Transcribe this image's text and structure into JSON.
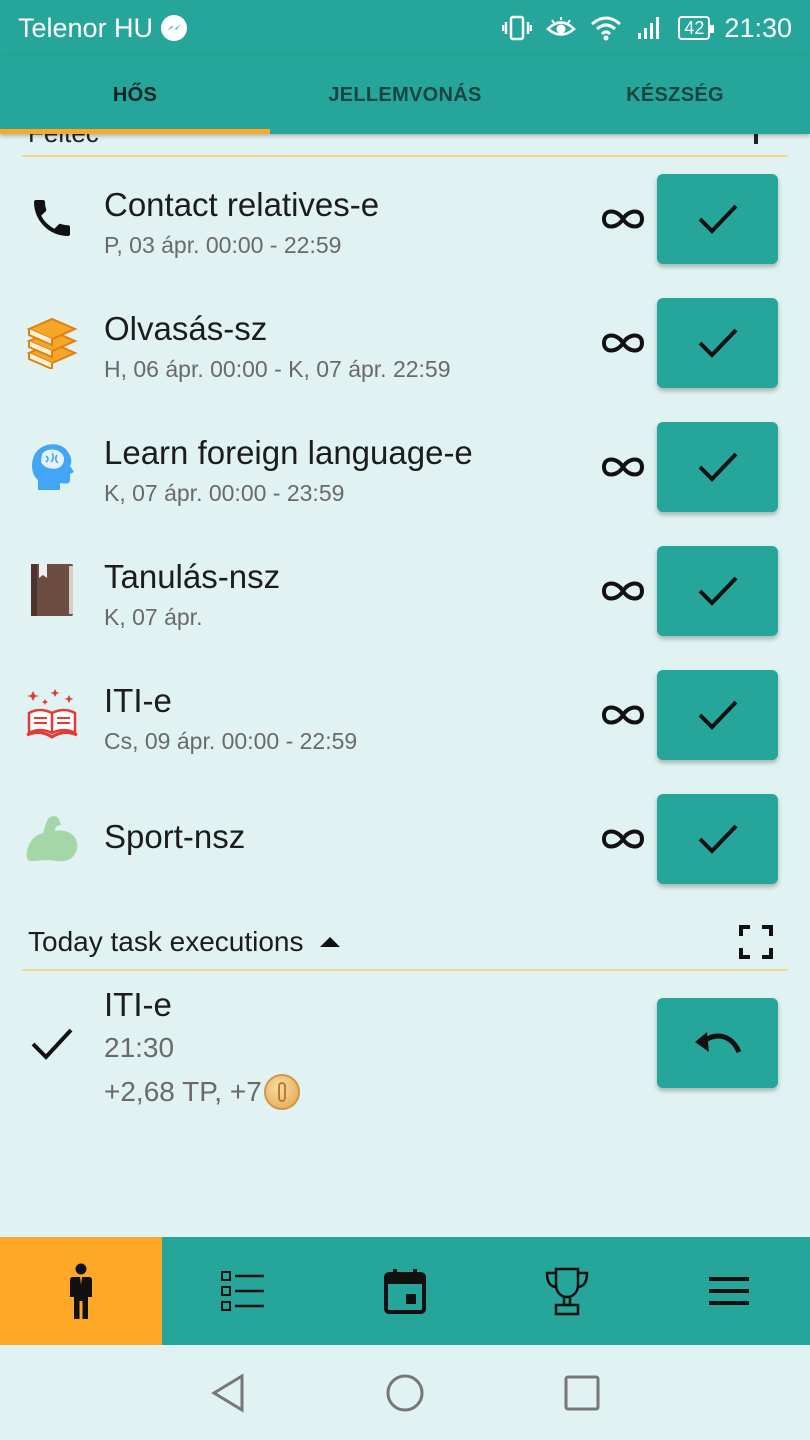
{
  "status_bar": {
    "carrier": "Telenor HU",
    "battery": "42",
    "time": "21:30"
  },
  "tabs": [
    {
      "label": "HŐS",
      "active": true
    },
    {
      "label": "JELLEMVONÁS",
      "active": false
    },
    {
      "label": "KÉSZSÉG",
      "active": false
    }
  ],
  "hidden_section_title": "Feltec",
  "tasks": [
    {
      "title": "Contact relatives-e",
      "subtitle": "P, 03 ápr. 00:00 - 22:59",
      "icon": "phone-icon",
      "repeat": "infinity-icon"
    },
    {
      "title": "Olvasás-sz",
      "subtitle": "H, 06 ápr. 00:00 - K, 07 ápr. 22:59",
      "icon": "books-stack-icon",
      "repeat": "infinity-icon"
    },
    {
      "title": "Learn foreign language-e",
      "subtitle": "K, 07 ápr. 00:00 - 23:59",
      "icon": "brain-head-icon",
      "repeat": "infinity-icon"
    },
    {
      "title": "Tanulás-nsz",
      "subtitle": "K, 07 ápr.",
      "icon": "book-icon",
      "repeat": "infinity-icon"
    },
    {
      "title": "ITI-e",
      "subtitle": "Cs, 09 ápr. 00:00 - 22:59",
      "icon": "magic-book-icon",
      "repeat": "infinity-icon"
    },
    {
      "title": "Sport-nsz",
      "subtitle": "",
      "icon": "flexed-arm-icon",
      "repeat": "infinity-icon"
    }
  ],
  "today": {
    "header": "Today task executions",
    "execution": {
      "title": "ITI-e",
      "time": "21:30",
      "reward": "+2,68 TP, +7"
    }
  },
  "bottom_nav": [
    {
      "icon": "hero-person-icon",
      "active": true
    },
    {
      "icon": "task-list-icon",
      "active": false
    },
    {
      "icon": "calendar-icon",
      "active": false
    },
    {
      "icon": "trophy-icon",
      "active": false
    },
    {
      "icon": "menu-icon",
      "active": false
    }
  ],
  "colors": {
    "primary": "#26a69a",
    "accent": "#ffa726",
    "background": "#e0f2f1",
    "divider": "#f3d98b"
  }
}
